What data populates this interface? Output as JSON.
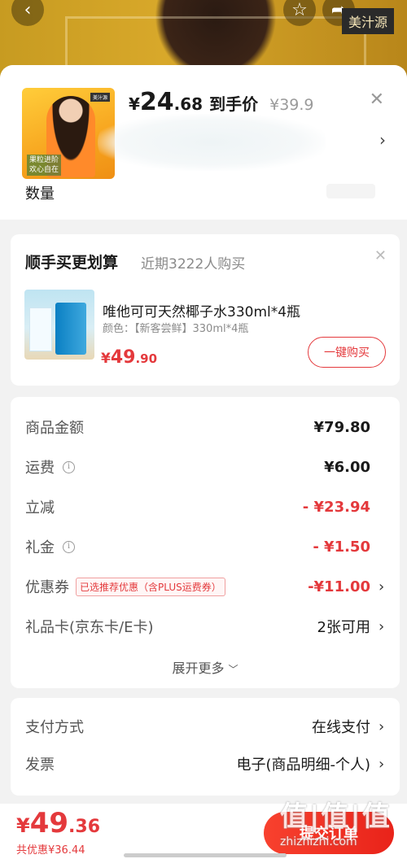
{
  "top": {
    "brand_tag": "美汁源"
  },
  "header": {
    "thumb_caption_line1": "果粒进阶",
    "thumb_caption_line2": "欢心自在",
    "thumb_mini_tag": "美汁源",
    "price_symbol": "¥",
    "price_int": "24",
    "price_dec": ".68",
    "price_tag": "到手价",
    "orig_price": "¥39.9",
    "qty_label": "数量"
  },
  "upsell": {
    "title": "顺手买更划算",
    "subtitle": "近期3222人购买",
    "product_name": "唯他可可天然椰子水330ml*4瓶",
    "product_spec": "颜色：【新客尝鲜】330ml*4瓶",
    "price_symbol": "¥",
    "price_int": "49",
    "price_dec": ".90",
    "buy_label": "一键购买"
  },
  "summary": {
    "rows": [
      {
        "label": "商品金额",
        "value": "¥79.80"
      },
      {
        "label": "运费",
        "value": "¥6.00"
      },
      {
        "label": "立减",
        "value": "- ¥23.94"
      },
      {
        "label": "礼金",
        "value": "- ¥1.50"
      },
      {
        "label": "优惠券",
        "tag": "已选推荐优惠（含PLUS运费券）",
        "value": "-¥11.00"
      },
      {
        "label": "礼品卡(京东卡/E卡)",
        "value": "2张可用"
      }
    ],
    "expand_label": "展开更多"
  },
  "payment": {
    "method_label": "支付方式",
    "method_value": "在线支付",
    "invoice_label": "发票",
    "invoice_value": "电子(商品明细-个人)"
  },
  "bottom": {
    "price_symbol": "¥",
    "total_int": "49",
    "total_dec": ".36",
    "saving": "共优惠¥36.44",
    "submit_label": "提交订单"
  },
  "watermark": {
    "big": "值|值|值",
    "small": "zhizhizhi.com"
  },
  "colors": {
    "accent_red": "#e4393c",
    "background": "#f2f2f2"
  }
}
